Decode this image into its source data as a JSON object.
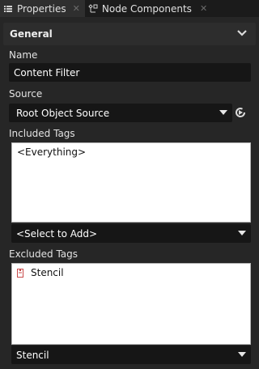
{
  "tabs": [
    {
      "label": "Properties",
      "icon": "list-icon",
      "active": true
    },
    {
      "label": "Node Components",
      "icon": "components-icon",
      "active": false
    }
  ],
  "group": {
    "title": "General"
  },
  "name": {
    "label": "Name",
    "value": "Content Filter"
  },
  "source": {
    "label": "Source",
    "value": "Root Object Source"
  },
  "included_tags": {
    "label": "Included Tags",
    "items": [
      "<Everything>"
    ],
    "select_value": "<Select to Add>"
  },
  "excluded_tags": {
    "label": "Excluded Tags",
    "items": [
      "Stencil"
    ],
    "select_value": "Stencil"
  },
  "colors": {
    "accent_red": "#c74a4a",
    "panel": "#262626",
    "field": "#161616"
  }
}
